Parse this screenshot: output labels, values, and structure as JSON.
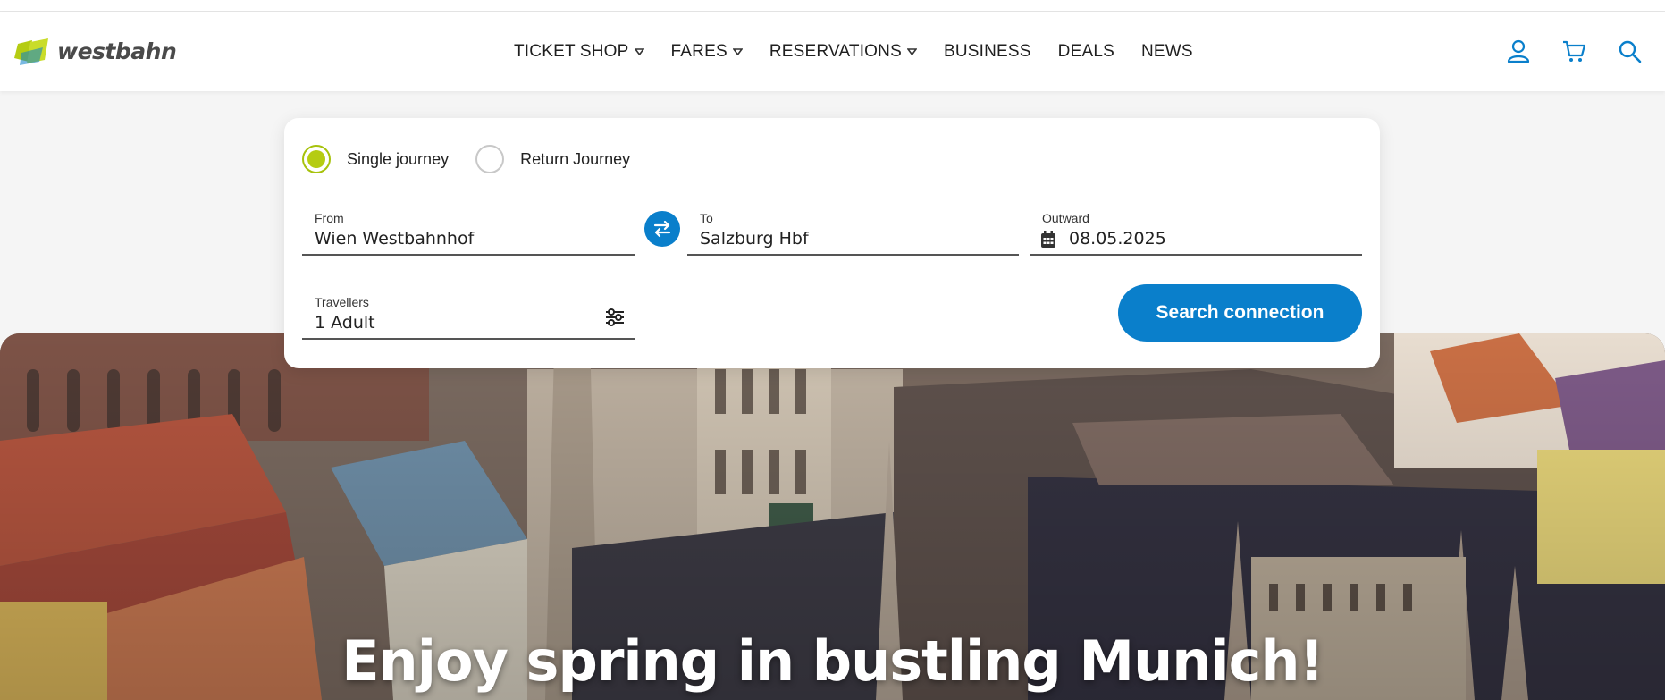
{
  "brand": {
    "name": "westbahn",
    "colors": {
      "lime": "#b5cc12",
      "blue": "#0a7fcb",
      "logo_text": "#4a4a4a"
    }
  },
  "nav": {
    "items": [
      {
        "label": "TICKET SHOP",
        "has_dropdown": true
      },
      {
        "label": "FARES",
        "has_dropdown": true
      },
      {
        "label": "RESERVATIONS",
        "has_dropdown": true
      },
      {
        "label": "BUSINESS",
        "has_dropdown": false
      },
      {
        "label": "DEALS",
        "has_dropdown": false
      },
      {
        "label": "NEWS",
        "has_dropdown": false
      }
    ],
    "icons": [
      "user-icon",
      "cart-icon",
      "search-icon"
    ]
  },
  "booking": {
    "journey_options": [
      {
        "label": "Single journey",
        "checked": true
      },
      {
        "label": "Return Journey",
        "checked": false
      }
    ],
    "from": {
      "label": "From",
      "value": "Wien Westbahnhof"
    },
    "to": {
      "label": "To",
      "value": "Salzburg Hbf"
    },
    "outward": {
      "label": "Outward",
      "value": "08.05.2025"
    },
    "travellers": {
      "label": "Travellers",
      "value": "1 Adult"
    },
    "search_button": "Search connection"
  },
  "hero": {
    "headline": "Enjoy spring in bustling Munich!"
  }
}
